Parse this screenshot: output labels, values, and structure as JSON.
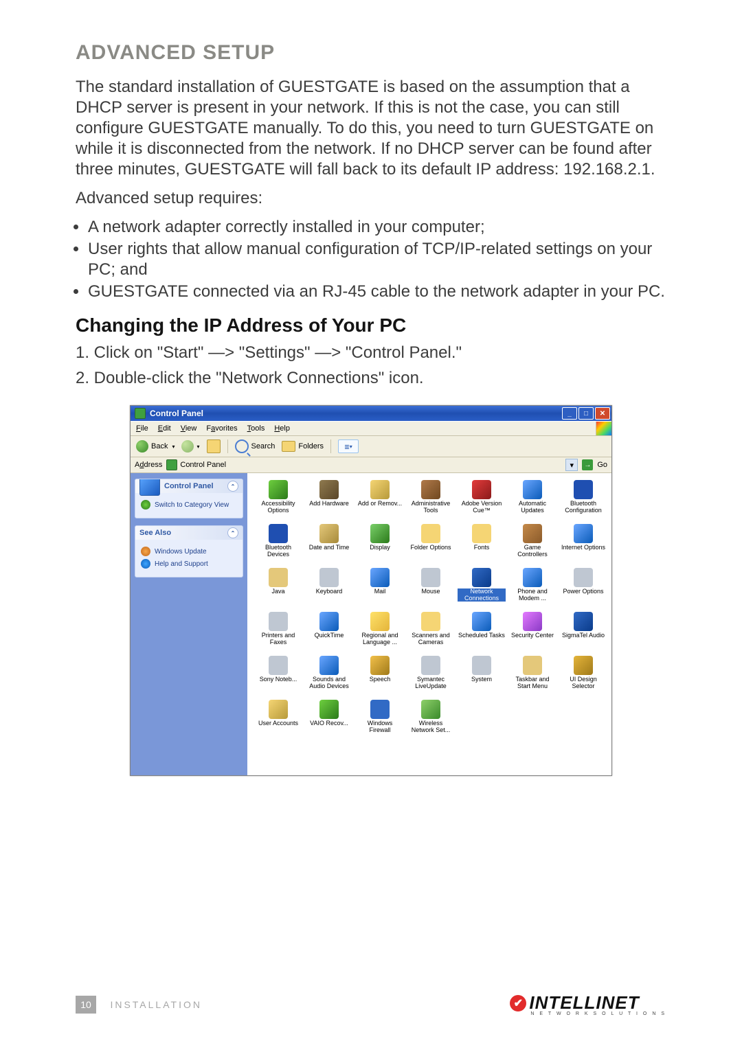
{
  "section_title": "ADVANCED SETUP",
  "intro": "The standard installation of GUESTGATE is based on the assumption that a DHCP server is present in your network. If this is not the case, you can still configure GUESTGATE manually. To do this, you need to turn GUESTGATE on while it is disconnected from the network. If no DHCP server can be found after three minutes, GUESTGATE will fall back to its default IP address: 192.168.2.1.",
  "requires_lead": "Advanced setup requires:",
  "requires": [
    "A network adapter correctly installed in your computer;",
    "User rights that allow manual configuration of TCP/IP-related settings on your PC; and",
    "GUESTGATE connected via an RJ-45 cable to the network adapter in your PC."
  ],
  "subheading": "Changing the IP Address of Your PC",
  "steps": [
    "1. Click on \"Start\" —> \"Settings\" —> \"Control Panel.\"",
    "2. Double-click the \"Network Connections\" icon."
  ],
  "screenshot": {
    "window_title": "Control Panel",
    "menus": [
      "File",
      "Edit",
      "View",
      "Favorites",
      "Tools",
      "Help"
    ],
    "toolbar": {
      "back": "Back",
      "search": "Search",
      "folders": "Folders"
    },
    "address_label": "Address",
    "address_value": "Control Panel",
    "go_label": "Go",
    "sidebar": {
      "panel1_title": "Control Panel",
      "panel1_link": "Switch to Category View",
      "panel2_title": "See Also",
      "panel2_links": [
        "Windows Update",
        "Help and Support"
      ]
    },
    "items": [
      "Accessibility Options",
      "Add Hardware",
      "Add or Remov...",
      "Administrative Tools",
      "Adobe Version Cue™",
      "Automatic Updates",
      "Bluetooth Configuration",
      "Bluetooth Devices",
      "Date and Time",
      "Display",
      "Folder Options",
      "Fonts",
      "Game Controllers",
      "Internet Options",
      "Java",
      "Keyboard",
      "Mail",
      "Mouse",
      "Network Connections",
      "Phone and Modem ...",
      "Power Options",
      "Printers and Faxes",
      "QuickTime",
      "Regional and Language ...",
      "Scanners and Cameras",
      "Scheduled Tasks",
      "Security Center",
      "SigmaTel Audio",
      "Sony Noteb...",
      "Sounds and Audio Devices",
      "Speech",
      "Symantec LiveUpdate",
      "System",
      "Taskbar and Start Menu",
      "UI Design Selector",
      "User Accounts",
      "VAIO Recov...",
      "Windows Firewall",
      "Wireless Network Set..."
    ],
    "selected_index": 18
  },
  "footer": {
    "page_number": "10",
    "section": "INSTALLATION",
    "brand": "INTELLINET",
    "brand_sub": "N E T W O R K   S O L U T I O N S"
  }
}
